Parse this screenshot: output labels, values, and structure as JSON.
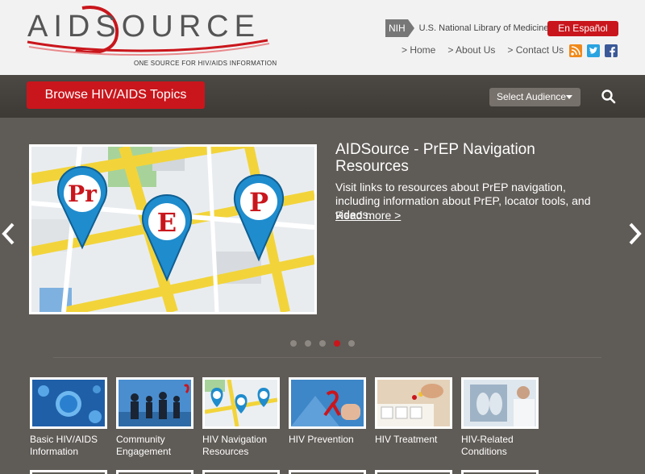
{
  "header": {
    "logo_text": "AIDSOURCE",
    "logo_tagline": "ONE SOURCE FOR HIV/AIDS INFORMATION",
    "nih_badge": "NIH",
    "nih_label": "U.S. National Library of Medicine",
    "espanol_label": "En Español",
    "links": [
      "> Home",
      "> About Us",
      "> Contact Us"
    ],
    "social_icons": [
      "rss-icon",
      "twitter-icon",
      "facebook-icon"
    ]
  },
  "nav": {
    "browse_label": "Browse HIV/AIDS Topics",
    "audience_label": "Select Audience"
  },
  "carousel": {
    "title": "AIDSource - PrEP Navigation Resources",
    "description": "Visit links to resources about PrEP navigation, including information about PrEP, locator tools, and videos.",
    "read_more": "Read more >",
    "slide_markers": [
      "Pr",
      "E",
      "P"
    ],
    "dot_count": 5,
    "active_dot": 4
  },
  "topics": [
    {
      "label": "Basic HIV/AIDS Information"
    },
    {
      "label": "Community Engagement"
    },
    {
      "label": "HIV Navigation Resources"
    },
    {
      "label": "HIV Prevention"
    },
    {
      "label": "HIV Treatment"
    },
    {
      "label": "HIV-Related Conditions"
    }
  ],
  "colors": {
    "brand_red": "#c9161c",
    "nav_bg": "#45413d",
    "body_bg": "#5f5b56"
  }
}
